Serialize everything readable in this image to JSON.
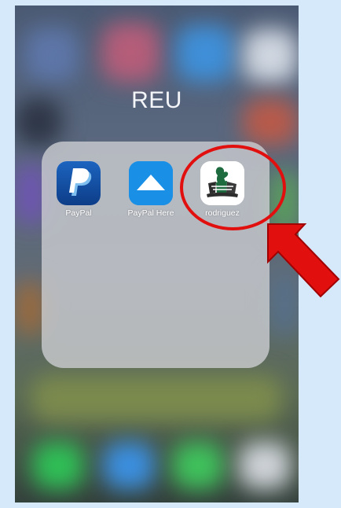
{
  "folder": {
    "title": "REU",
    "apps": [
      {
        "label": "PayPal",
        "icon": "paypal-logo-icon"
      },
      {
        "label": "PayPal Here",
        "icon": "paypal-here-triangle-icon"
      },
      {
        "label": "rodriguez",
        "icon": "rodriguez-app-logo-icon"
      }
    ]
  },
  "annotation": {
    "highlight_color": "#e20f0f",
    "highlight_target": "rodriguez"
  },
  "colors": {
    "page_background": "#d5e9fb",
    "paypal_dark": "#0d3d88",
    "paypal_light": "#2399e0",
    "paypal_here_blue": "#1a8fe6"
  }
}
